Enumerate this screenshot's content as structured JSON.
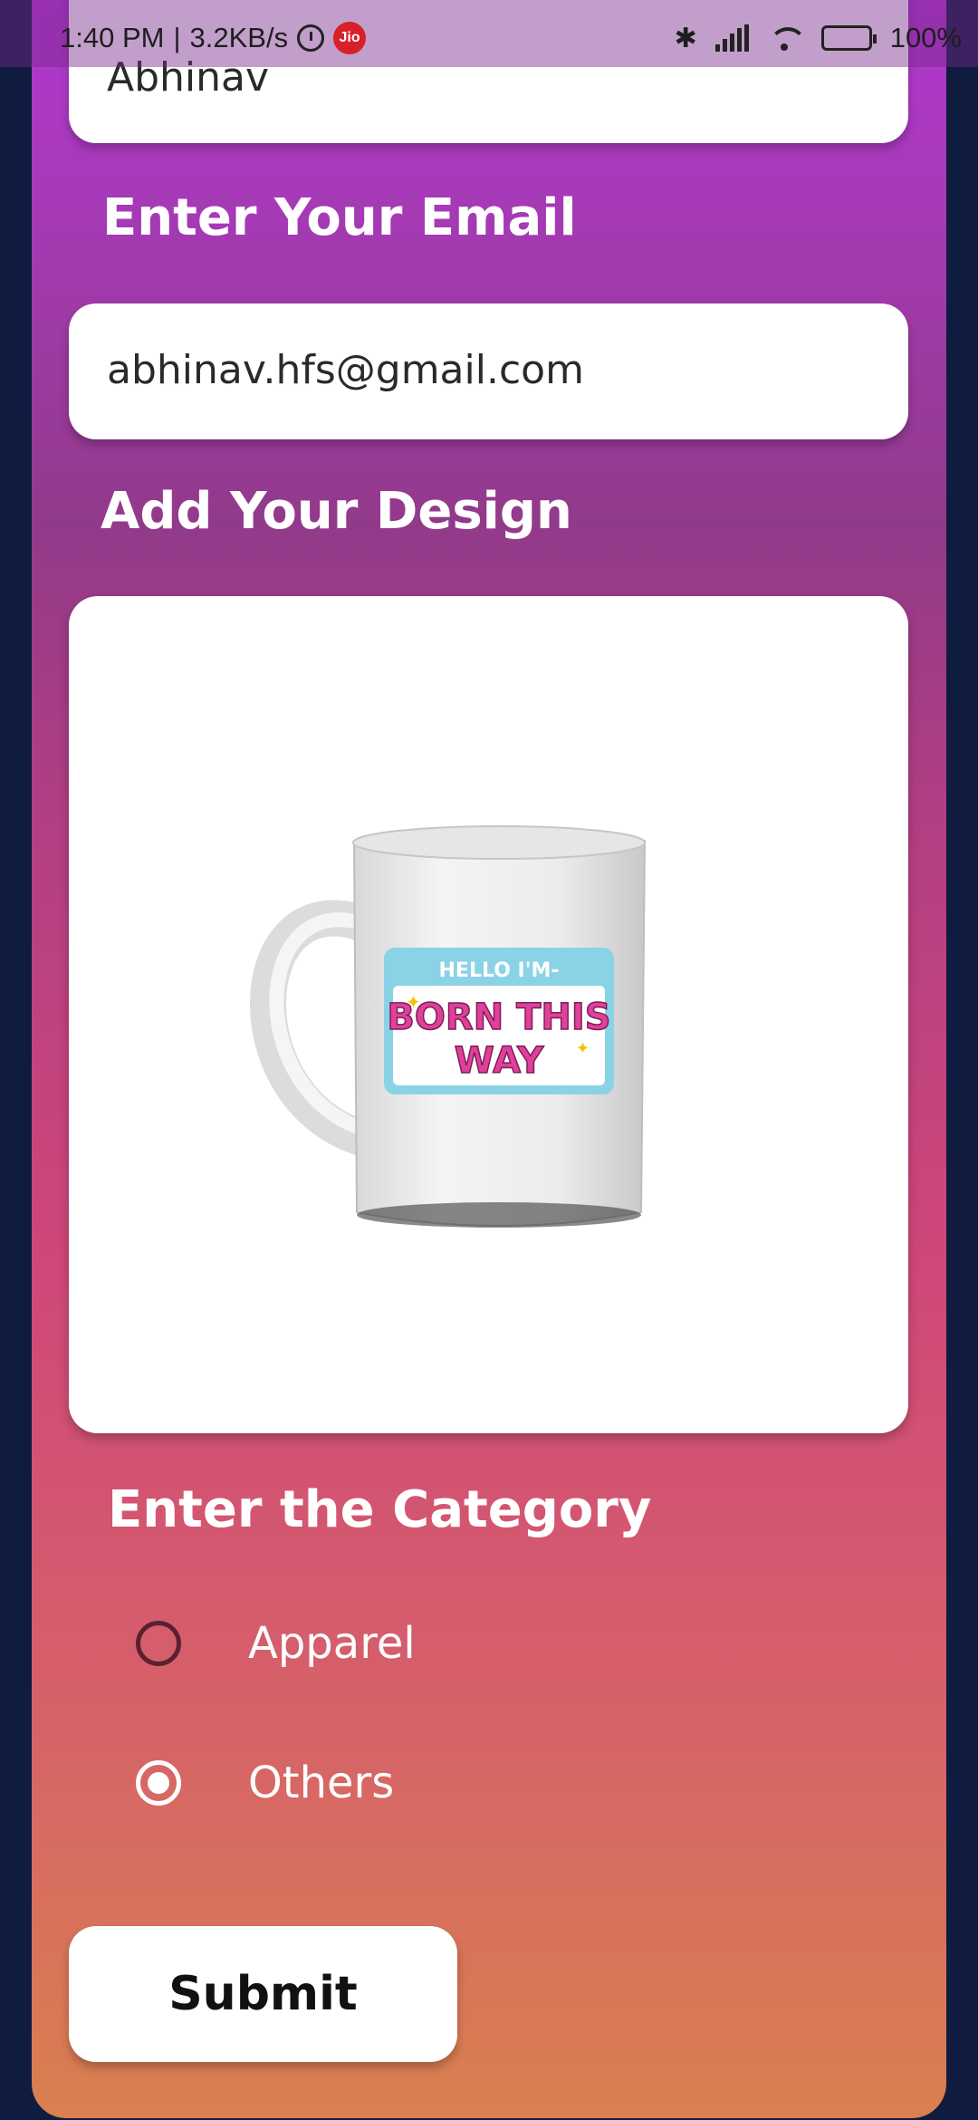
{
  "status_bar": {
    "time": "1:40 PM",
    "separator": "|",
    "speed": "3.2KB/s",
    "carrier_badge": "Jio",
    "battery": "100%"
  },
  "form": {
    "name_value": "Abhinav",
    "email_label": "Enter Your Email",
    "email_value": "abhinav.hfs@gmail.com",
    "design_label": "Add Your Design",
    "design_image": {
      "icon": "mug-image",
      "sticker_line1": "HELLO I'M-",
      "sticker_line2": "BORN THIS",
      "sticker_line3": "WAY"
    },
    "category_label": "Enter the Category",
    "options": [
      {
        "label": "Apparel",
        "selected": false
      },
      {
        "label": "Others",
        "selected": true
      }
    ],
    "submit_label": "Submit"
  },
  "colors": {
    "background": "#0f1c3f",
    "gradient_top": "#b437d4",
    "gradient_bottom": "#d9804f"
  }
}
